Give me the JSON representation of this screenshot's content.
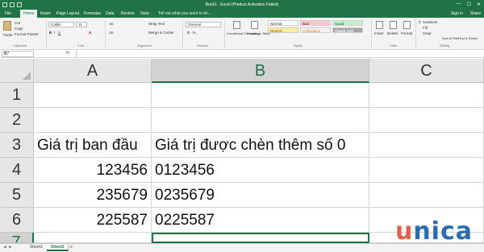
{
  "titlebar": {
    "title": "Book1 - Excel (Product Activation Failed)",
    "minimize": "—",
    "maximize": "☐",
    "close": "✕"
  },
  "tabs": [
    "File",
    "Home",
    "Insert",
    "Page Layout",
    "Formulas",
    "Data",
    "Review",
    "View"
  ],
  "active_tab": "Home",
  "tell_me": "Tell me what you want to do...",
  "sign_in": "Sign in",
  "share": "Share",
  "ribbon": {
    "clipboard": {
      "paste": "Paste",
      "cut": "Cut",
      "copy": "Copy",
      "format_painter": "Format Painter",
      "label": "Clipboard"
    },
    "font": {
      "name": "Calibri",
      "size": "11",
      "label": "Font"
    },
    "alignment": {
      "wrap_text": "Wrap Text",
      "merge_center": "Merge & Center",
      "label": "Alignment"
    },
    "number": {
      "format": "General",
      "label": "Number"
    },
    "styles": {
      "conditional": "Conditional Formatting",
      "format_table": "Format as Table",
      "normal": "Normal",
      "bad": "Bad",
      "good": "Good",
      "neutral": "Neutral",
      "calculation": "Calculation",
      "check_cell": "Check Cell",
      "label": "Styles"
    },
    "cells": {
      "insert": "Insert",
      "delete": "Delete",
      "format": "Format",
      "label": "Cells"
    },
    "editing": {
      "autosum": "AutoSum",
      "fill": "Fill",
      "clear": "Clear",
      "sort_filter": "Sort & Filter",
      "find_select": "Find & Select",
      "label": "Editing"
    }
  },
  "formula_bar": {
    "name_box": "B7",
    "fx": "fx",
    "value": ""
  },
  "columns": [
    "A",
    "B",
    "C"
  ],
  "rows": [
    {
      "num": "1",
      "a": "",
      "b": ""
    },
    {
      "num": "2",
      "a": "",
      "b": ""
    },
    {
      "num": "3",
      "a": "Giá trị ban đầu",
      "b": "Giá trị được chèn thêm số 0"
    },
    {
      "num": "4",
      "a": "123456",
      "b": "0123456"
    },
    {
      "num": "5",
      "a": "235679",
      "b": "0235679"
    },
    {
      "num": "6",
      "a": "225587",
      "b": "0225587"
    },
    {
      "num": "7",
      "a": "",
      "b": ""
    }
  ],
  "sheets": [
    "Sheet1",
    "Sheet2"
  ],
  "active_sheet": "Sheet2",
  "watermark": {
    "u": "u",
    "rest": "nica"
  },
  "colors": {
    "excel_green": "#217346",
    "watermark_red": "#e0614b",
    "watermark_blue": "#2b6cb0"
  }
}
